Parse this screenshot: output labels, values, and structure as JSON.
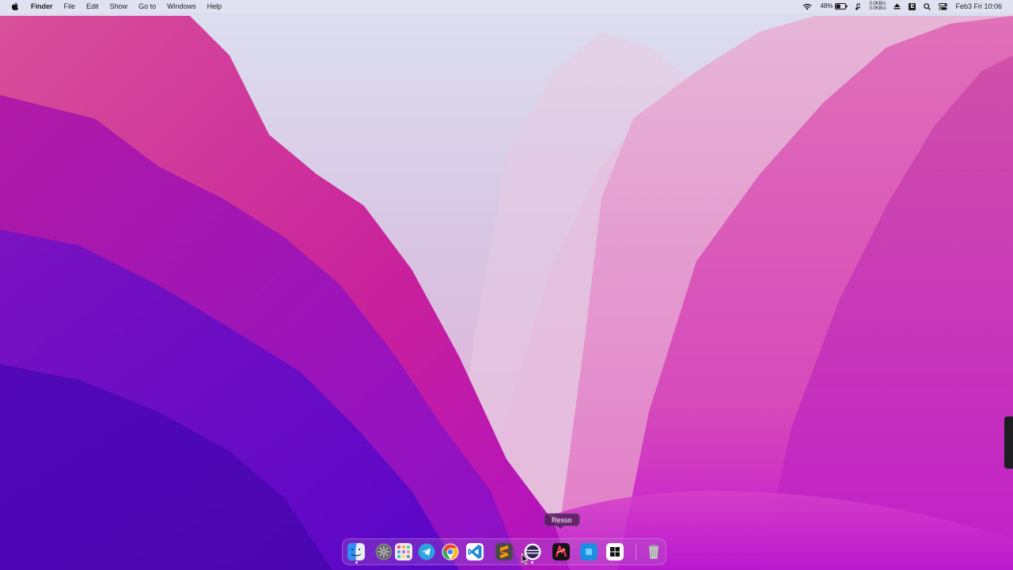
{
  "menubar": {
    "apple_icon": "apple-icon",
    "app_name": "Finder",
    "menus": [
      "File",
      "Edit",
      "Show",
      "Go to",
      "Windows",
      "Help"
    ],
    "status": {
      "wifi_icon": "wifi-icon",
      "battery_percent": "48%",
      "battery_level": 0.48,
      "net_up": "0.0KB/s",
      "net_down": "0.0KB/s",
      "e_badge": "E",
      "clock": "Feb3 Fri 10:06"
    }
  },
  "dock": {
    "tooltip": "Resso",
    "items": [
      {
        "name": "finder",
        "icon": "finder-icon",
        "color": "#3aa0f0"
      },
      {
        "name": "system-preferences",
        "icon": "gear-icon",
        "color": "#8a8a8a"
      },
      {
        "name": "launchpad",
        "icon": "launchpad-grid-icon",
        "color": "#e8e8ef"
      },
      {
        "name": "telegram",
        "icon": "telegram-icon",
        "color": "#2aa3e0"
      },
      {
        "name": "chrome",
        "icon": "chrome-icon",
        "color": "#ffffff"
      },
      {
        "name": "vscode",
        "icon": "vscode-icon",
        "color": "#1e88d6"
      },
      {
        "name": "sublime-text",
        "icon": "sublime-icon",
        "color": "#4a4a4a"
      },
      {
        "name": "eclipse",
        "icon": "eclipse-icon",
        "color": "#2c2255"
      },
      {
        "name": "resso",
        "icon": "resso-icon",
        "color": "#1a1a1a"
      },
      {
        "name": "blue-app",
        "icon": "window-app-icon",
        "color": "#1d8fe0"
      },
      {
        "name": "windows",
        "icon": "windows-icon",
        "color": "#ffffff"
      },
      {
        "name": "trash",
        "icon": "trash-icon",
        "color": "#c8c8cc"
      }
    ]
  }
}
